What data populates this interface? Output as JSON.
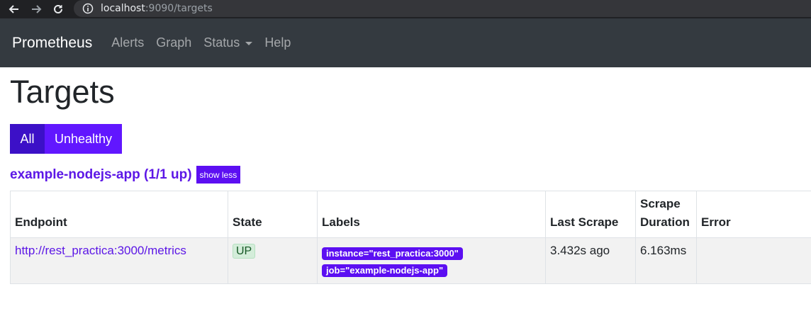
{
  "browser": {
    "url_host": "localhost",
    "url_rest": ":9090/targets"
  },
  "navbar": {
    "brand": "Prometheus",
    "links": [
      {
        "label": "Alerts"
      },
      {
        "label": "Graph"
      },
      {
        "label": "Status"
      },
      {
        "label": "Help"
      }
    ]
  },
  "page": {
    "title": "Targets",
    "filters": {
      "all": "All",
      "unhealthy": "Unhealthy"
    }
  },
  "pool": {
    "title": "example-nodejs-app (1/1 up)",
    "toggle": "show less",
    "columns": {
      "endpoint": "Endpoint",
      "state": "State",
      "labels": "Labels",
      "last_scrape": "Last Scrape",
      "scrape_duration_1": "Scrape",
      "scrape_duration_2": "Duration",
      "error": "Error"
    },
    "rows": [
      {
        "endpoint": "http://rest_practica:3000/metrics",
        "state": "UP",
        "labels": [
          "instance=\"rest_practica:3000\"",
          "job=\"example-nodejs-app\""
        ],
        "last_scrape": "3.432s ago",
        "scrape_duration": "6.163ms",
        "error": ""
      }
    ]
  },
  "colors": {
    "navbar": "#343a40",
    "accent": "#5c0ff2",
    "filter_active": "#3c10c7",
    "state_up_bg": "#d4edda"
  }
}
